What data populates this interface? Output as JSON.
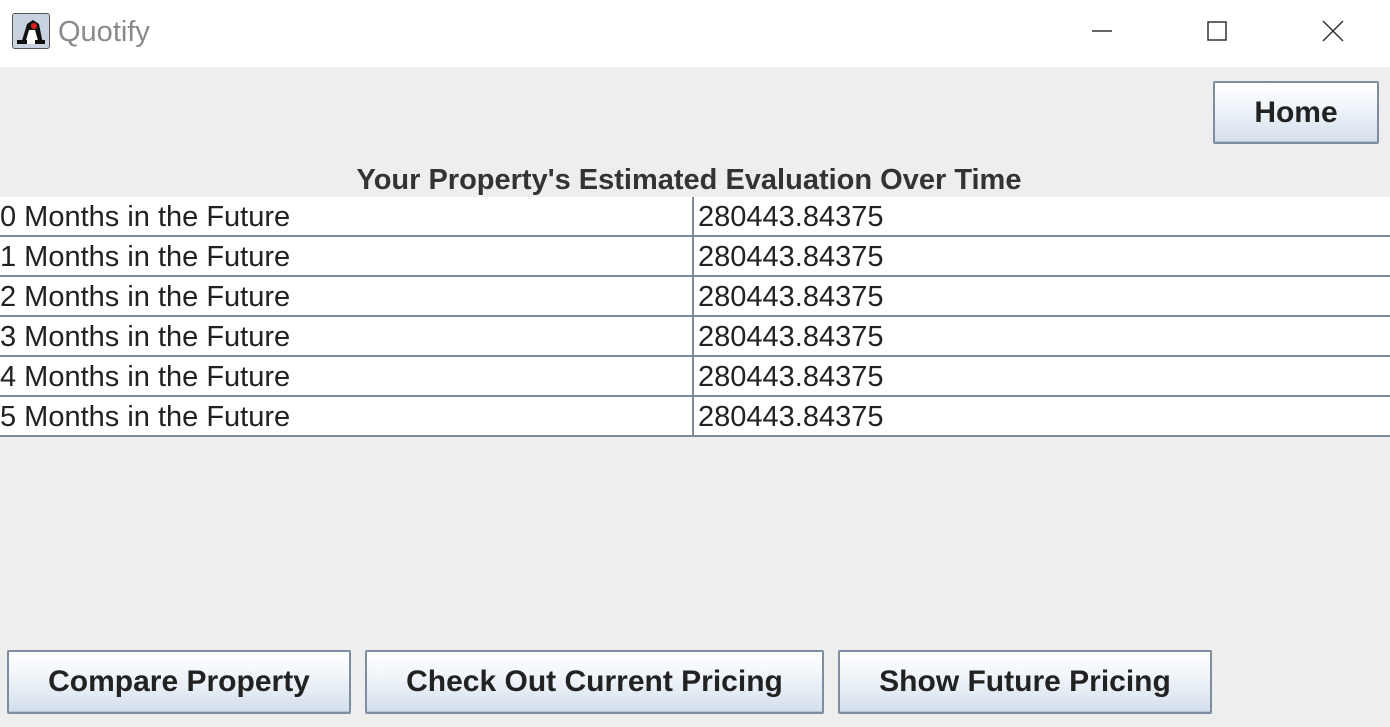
{
  "window": {
    "title": "Quotify",
    "app_icon": "java-duke-icon",
    "controls": {
      "minimize_icon": "minimize-icon",
      "maximize_icon": "maximize-icon",
      "close_icon": "close-icon"
    }
  },
  "header": {
    "home_label": "Home"
  },
  "table": {
    "title": "Your Property's Estimated Evaluation Over Time",
    "rows": [
      {
        "period": "0 Months in the Future",
        "value": "280443.84375"
      },
      {
        "period": "1 Months in the Future",
        "value": "280443.84375"
      },
      {
        "period": "2 Months in the Future",
        "value": "280443.84375"
      },
      {
        "period": "3 Months in the Future",
        "value": "280443.84375"
      },
      {
        "period": "4 Months in the Future",
        "value": "280443.84375"
      },
      {
        "period": "5 Months in the Future",
        "value": "280443.84375"
      }
    ]
  },
  "footer": {
    "compare_label": "Compare Property",
    "current_pricing_label": "Check Out Current Pricing",
    "future_pricing_label": "Show Future Pricing"
  },
  "colors": {
    "background": "#eeeeee",
    "titlebar": "#ffffff",
    "grid_line": "#7d8a97",
    "button_border": "#7d8ea0"
  }
}
